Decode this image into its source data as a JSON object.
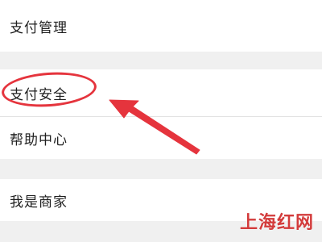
{
  "menu": {
    "items": [
      {
        "label": "支付管理"
      },
      {
        "label": "支付安全"
      },
      {
        "label": "帮助中心"
      },
      {
        "label": "我是商家"
      }
    ]
  },
  "annotation": {
    "color": "#e5343d"
  },
  "watermark": {
    "text": "上海红网",
    "color": "#d33b3b"
  }
}
